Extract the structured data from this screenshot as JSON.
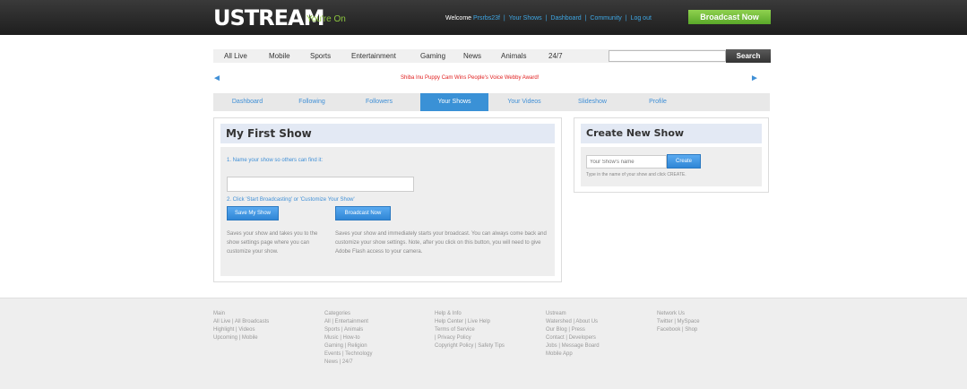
{
  "header": {
    "logo": "USTREAM",
    "tagline": "You're On",
    "welcome_prefix": "Welcome",
    "username": "Prsrbs23f",
    "links": [
      "Your Shows",
      "Dashboard",
      "Community",
      "Log out"
    ],
    "broadcast_now": "Broadcast Now"
  },
  "nav": {
    "items": [
      "All Live",
      "Mobile",
      "Sports",
      "Entertainment",
      "Gaming",
      "News",
      "Animals",
      "24/7"
    ],
    "search_value": "",
    "search_button": "Search"
  },
  "promo": {
    "text": "Shiba Inu Puppy Cam Wins People's Voice Webby Award!",
    "prev_arrow": "◄",
    "next_arrow": "►"
  },
  "tabs": {
    "items": [
      "Dashboard",
      "Following",
      "Followers",
      "Your Shows",
      "Your Videos",
      "Slideshow",
      "Profile"
    ],
    "active": "Your Shows"
  },
  "my_show": {
    "title": "My First Show",
    "step1": "1. Name your show so others can find it:",
    "name_value": "",
    "step2": "2. Click 'Start Broadcasting' or 'Customize Your Show'",
    "save_button": "Save My Show",
    "broadcast_button": "Broadcast Now",
    "save_desc": "Saves your show and takes you to the show settings page where you can customize your show.",
    "broadcast_desc": "Saves your show and immediately starts your broadcast. You can always come back and customize your show settings. Note, after you click on this button, you will need to give Adobe Flash access to your camera."
  },
  "create_show": {
    "title": "Create New Show",
    "input_placeholder": "Your Show's name",
    "create_button": "Create",
    "hint": "Type in the name of your show and click CREATE."
  },
  "footer": {
    "columns": [
      {
        "heading": "Main",
        "lines": [
          "All Live | All Broadcasts",
          "Highlight | Videos",
          "Upcoming | Mobile"
        ]
      },
      {
        "heading": "Categories",
        "lines": [
          "All | Entertainment",
          "Sports | Animals",
          "Music | How-to",
          "Gaming | Religion",
          "Events | Technology",
          "News | 24/7"
        ]
      },
      {
        "heading": "Help & Info",
        "lines": [
          "Help Center | Live Help",
          "Terms of Service",
          "| Privacy Policy",
          "Copyright Policy | Safety Tips"
        ]
      },
      {
        "heading": "Ustream",
        "lines": [
          "Watershed | About Us",
          "Our Blog | Press",
          "Contact | Developers",
          "Jobs | Message Board",
          "Mobile App"
        ]
      },
      {
        "heading": "Network Us",
        "lines": [
          "Twitter | MySpace",
          "Facebook | Shop"
        ]
      }
    ]
  },
  "colors": {
    "topbar": "#262626",
    "accent_green": "#8dc63f",
    "link_blue": "#3f8fd6",
    "active_tab": "#3a91d6",
    "promo_red": "#e02020"
  }
}
